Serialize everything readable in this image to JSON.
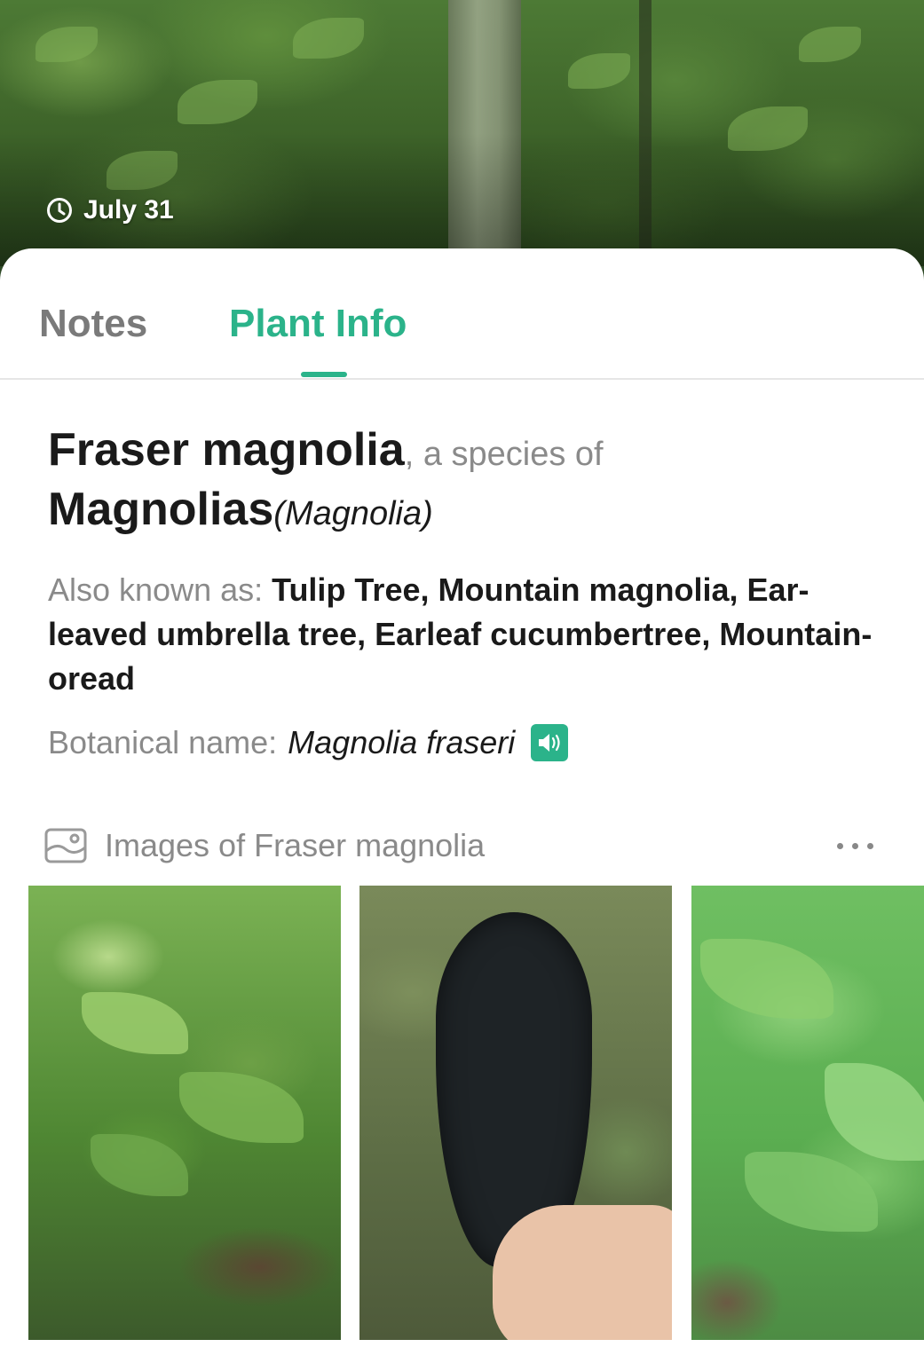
{
  "hero": {
    "date": "July 31",
    "clock_icon": "clock-icon"
  },
  "tabs": [
    {
      "label": "Notes",
      "active": false
    },
    {
      "label": "Plant Info",
      "active": true
    }
  ],
  "plant": {
    "common_name": "Fraser magnolia",
    "species_of_text": ", a species of",
    "genus_common": "Magnolias",
    "genus_latin": "(Magnolia)",
    "aka_label": "Also known as: ",
    "aka_value": "Tulip Tree, Mountain magnolia, Ear-leaved umbrella tree, Earleaf cucumbertree, Mountain-oread",
    "botanical_label": "Botanical name:",
    "botanical_value": "Magnolia fraseri",
    "speaker_icon": "speaker-icon"
  },
  "images_section": {
    "title": "Images of Fraser magnolia",
    "icon": "gallery-icon",
    "more_icon": "more-dots-icon"
  },
  "colors": {
    "accent": "#2bb38a",
    "muted_text": "#8a8a8a",
    "primary_text": "#1a1a1a",
    "inactive_tab": "#7a7a7a"
  }
}
